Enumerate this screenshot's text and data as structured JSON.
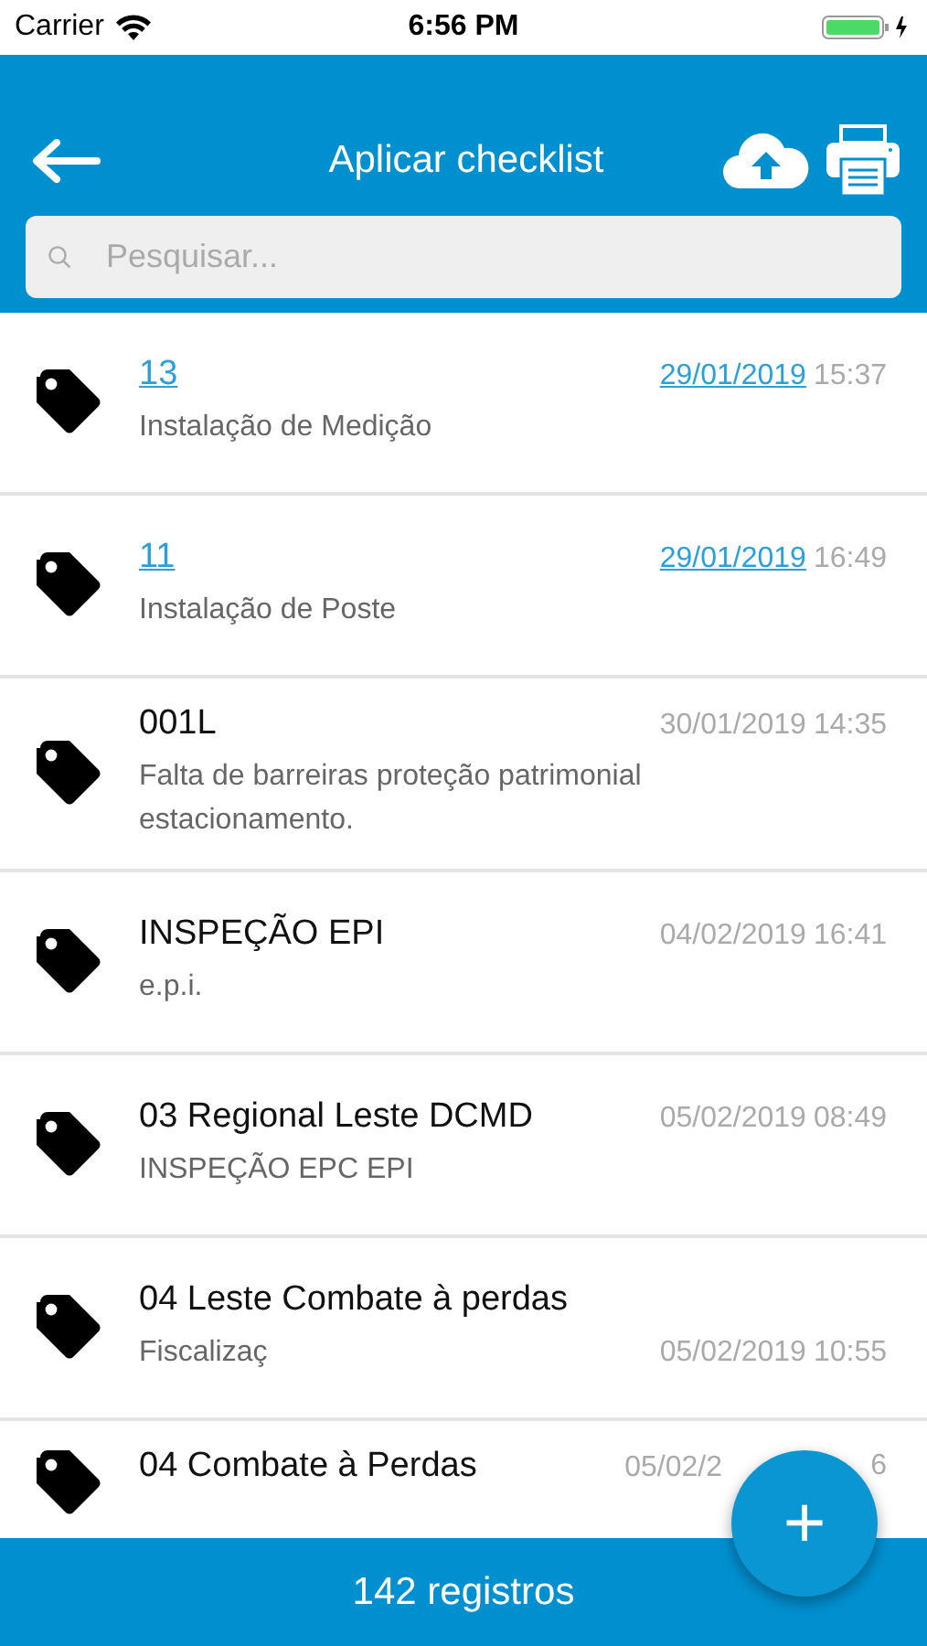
{
  "status_bar": {
    "carrier": "Carrier",
    "time": "6:56 PM"
  },
  "header": {
    "title": "Aplicar checklist"
  },
  "search": {
    "placeholder": "Pesquisar..."
  },
  "items": [
    {
      "title": "13",
      "subtitle": "Instalação de Medição",
      "date": "29/01/2019",
      "time": "15:37",
      "linked": true,
      "kind": "inline"
    },
    {
      "title": "11",
      "subtitle": "Instalação de Poste",
      "date": "29/01/2019",
      "time": "16:49",
      "linked": true,
      "kind": "inline"
    },
    {
      "title": "001L",
      "subtitle": "Falta de barreiras proteção patrimonial estacionamento.",
      "date": "30/01/2019",
      "time": "14:35",
      "linked": false,
      "kind": "inline"
    },
    {
      "title": "INSPEÇÃO EPI",
      "subtitle": "e.p.i.",
      "date": "04/02/2019",
      "time": "16:41",
      "linked": false,
      "kind": "inline"
    },
    {
      "title": "03 Regional Leste DCMD",
      "subtitle": "INSPEÇÃO EPC EPI",
      "date": "05/02/2019",
      "time": "08:49",
      "linked": false,
      "kind": "inline"
    },
    {
      "title": "04 Leste Combate à perdas",
      "subtitle": "Fiscalizaç",
      "date": "05/02/2019",
      "time": "10:55",
      "linked": false,
      "kind": "stacked"
    },
    {
      "title": "04 Combate à Perdas",
      "date": "05/02/2",
      "time": "6",
      "linked": false,
      "kind": "partial"
    }
  ],
  "fab": {
    "label": "+"
  },
  "footer": {
    "count": "142 registros"
  }
}
